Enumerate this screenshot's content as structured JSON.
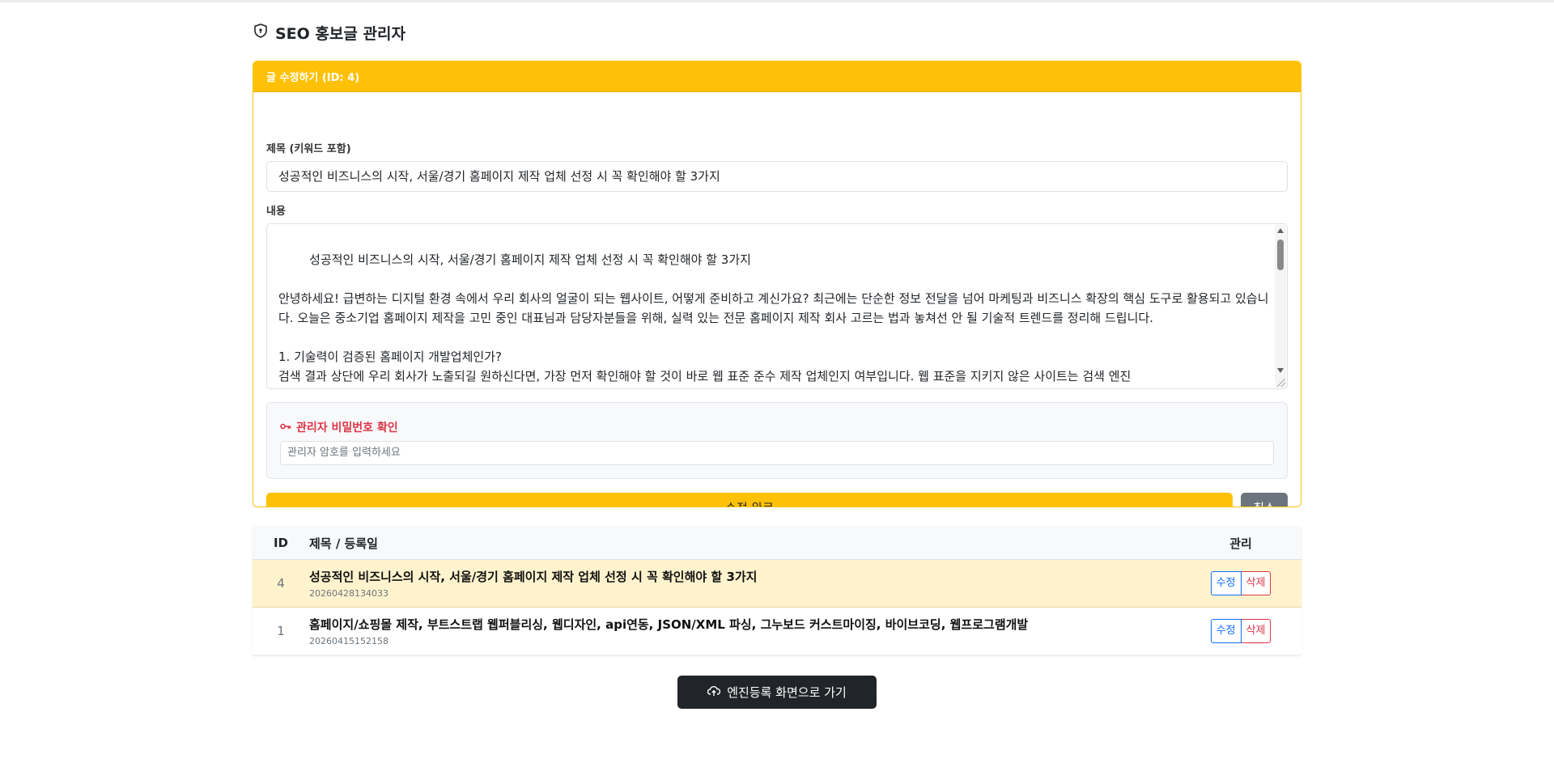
{
  "header": {
    "title": "SEO 홍보글 관리자"
  },
  "edit_form": {
    "card_title": "글 수정하기 (ID: 4)",
    "title_label": "제목 (키워드 포함)",
    "title_value": "성공적인 비즈니스의 시작, 서울/경기 홈페이지 제작 업체 선정 시 꼭 확인해야 할 3가지",
    "content_label": "내용",
    "content_value": "성공적인 비즈니스의 시작, 서울/경기 홈페이지 제작 업체 선정 시 꼭 확인해야 할 3가지\n\n안녕하세요! 급변하는 디지털 환경 속에서 우리 회사의 얼굴이 되는 웹사이트, 어떻게 준비하고 계신가요? 최근에는 단순한 정보 전달을 넘어 마케팅과 비즈니스 확장의 핵심 도구로 활용되고 있습니다. 오늘은 중소기업 홈페이지 제작을 고민 중인 대표님과 담당자분들을 위해, 실력 있는 전문 홈페이지 제작 회사 고르는 법과 놓쳐선 안 될 기술적 트렌드를 정리해 드립니다.\n\n1. 기술력이 검증된 홈페이지 개발업체인가?\n검색 결과 상단에 우리 회사가 노출되길 원하신다면, 가장 먼저 확인해야 할 것이 바로 웹 표준 준수 제작 업체인지 여부입니다. 웹 표준을 지키지 않은 사이트는 검색 엔진",
    "password_label": "관리자 비밀번호 확인",
    "password_placeholder": "관리자 암호를 입력하세요",
    "submit_label": "수정 완료",
    "cancel_label": "취소"
  },
  "table": {
    "headers": {
      "id": "ID",
      "title": "제목 / 등록일",
      "manage": "관리"
    },
    "rows": [
      {
        "id": "4",
        "title": "성공적인 비즈니스의 시작, 서울/경기 홈페이지 제작 업체 선정 시 꼭 확인해야 할 3가지",
        "date": "20260428134033",
        "edit_label": "수정",
        "delete_label": "삭제"
      },
      {
        "id": "1",
        "title": "홈페이지/쇼핑몰 제작, 부트스트랩 웹퍼블리싱, 웹디자인, api연동, JSON/XML 파싱, 그누보드 커스트마이징, 바이브코딩, 웹프로그램개발",
        "date": "20260415152158",
        "edit_label": "수정",
        "delete_label": "삭제"
      }
    ]
  },
  "footer": {
    "engine_button_label": "엔진등록 화면으로 가기"
  },
  "colors": {
    "accent": "#ffc107",
    "danger": "#dc3545",
    "primary": "#0d6efd",
    "dark": "#212529"
  }
}
